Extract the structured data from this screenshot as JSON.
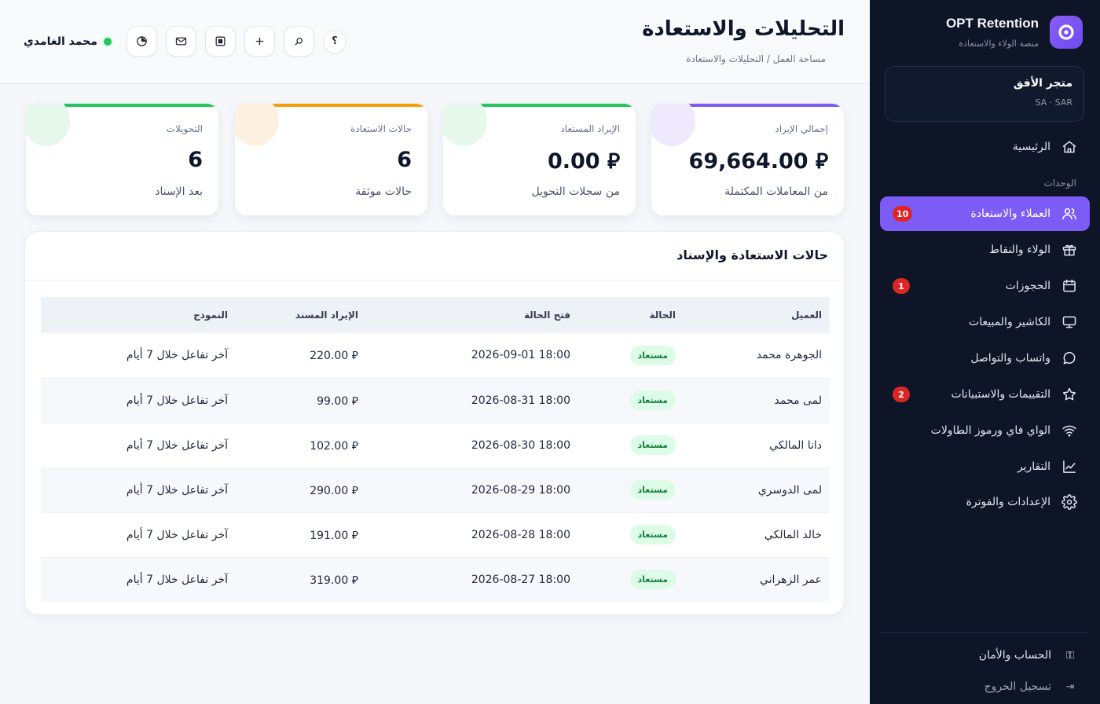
{
  "sidebar": {
    "brand_title": "OPT Retention",
    "brand_subtitle": "منصة الولاء والاستعادة",
    "store_name": "متجر الأفق",
    "store_region": "SA · SAR",
    "section_label": "الوحدات",
    "items": [
      {
        "label": "الرئيسية",
        "icon": "home-icon"
      },
      {
        "label": "العملاء والاستعادة",
        "icon": "users-icon",
        "badge": "10",
        "active": true
      },
      {
        "label": "الولاء والنقاط",
        "icon": "gift-icon"
      },
      {
        "label": "الحجوزات",
        "icon": "calendar-icon",
        "badge": "1"
      },
      {
        "label": "الكاشير والمبيعات",
        "icon": "monitor-icon"
      },
      {
        "label": "واتساب والتواصل",
        "icon": "chat-icon"
      },
      {
        "label": "التقييمات والاستبيانات",
        "icon": "star-icon",
        "badge": "2"
      },
      {
        "label": "الواي فاي ورموز الطاولات",
        "icon": "wifi-icon"
      },
      {
        "label": "التقارير",
        "icon": "chart-icon"
      },
      {
        "label": "الإعدادات والفوترة",
        "icon": "gear-icon"
      }
    ],
    "footer": {
      "account_label": "الحساب والأمان",
      "logout_label": "تسجيل الخروج"
    }
  },
  "header": {
    "title": "التحليلات والاستعادة",
    "breadcrumb": "مساحة العمل / التحليلات والاستعادة",
    "user_name": "محمد الغامدي",
    "help_label": "؟"
  },
  "kpis": [
    {
      "label": "إجمالي الإيراد",
      "value": "69,664.00 ⃁",
      "sub": "من المعاملات المكتملة",
      "accent": "#7c5cf5",
      "blob": "#efe9fe"
    },
    {
      "label": "الإيراد المستعاد",
      "value": "0.00 ⃁",
      "sub": "من سجلات التحويل",
      "accent": "#22c55e",
      "blob": "#e6f8ec"
    },
    {
      "label": "حالات الاستعادة",
      "value": "6",
      "sub": "حالات موثقة",
      "accent": "#f59e0b",
      "blob": "#fff1e2"
    },
    {
      "label": "التحويلات",
      "value": "6",
      "sub": "بعد الإسناد",
      "accent": "#22c55e",
      "blob": "#e6f8ec"
    }
  ],
  "table": {
    "title": "حالات الاستعادة والإسناد",
    "columns": [
      "العميل",
      "الحالة",
      "فتح الحالة",
      "الإيراد المسند",
      "النموذج"
    ],
    "rows": [
      {
        "customer": "الجوهرة محمد",
        "status": "مستعاد",
        "opened": "2026-09-01 18:00",
        "revenue": "220.00 ⃁",
        "model": "آخر تفاعل خلال 7 أيام"
      },
      {
        "customer": "لمى محمد",
        "status": "مستعاد",
        "opened": "2026-08-31 18:00",
        "revenue": "99.00 ⃁",
        "model": "آخر تفاعل خلال 7 أيام"
      },
      {
        "customer": "دانا المالكي",
        "status": "مستعاد",
        "opened": "2026-08-30 18:00",
        "revenue": "102.00 ⃁",
        "model": "آخر تفاعل خلال 7 أيام"
      },
      {
        "customer": "لمى الدوسري",
        "status": "مستعاد",
        "opened": "2026-08-29 18:00",
        "revenue": "290.00 ⃁",
        "model": "آخر تفاعل خلال 7 أيام"
      },
      {
        "customer": "خالد المالكي",
        "status": "مستعاد",
        "opened": "2026-08-28 18:00",
        "revenue": "191.00 ⃁",
        "model": "آخر تفاعل خلال 7 أيام"
      },
      {
        "customer": "عمر الزهراني",
        "status": "مستعاد",
        "opened": "2026-08-27 18:00",
        "revenue": "319.00 ⃁",
        "model": "آخر تفاعل خلال 7 أيام"
      }
    ]
  }
}
